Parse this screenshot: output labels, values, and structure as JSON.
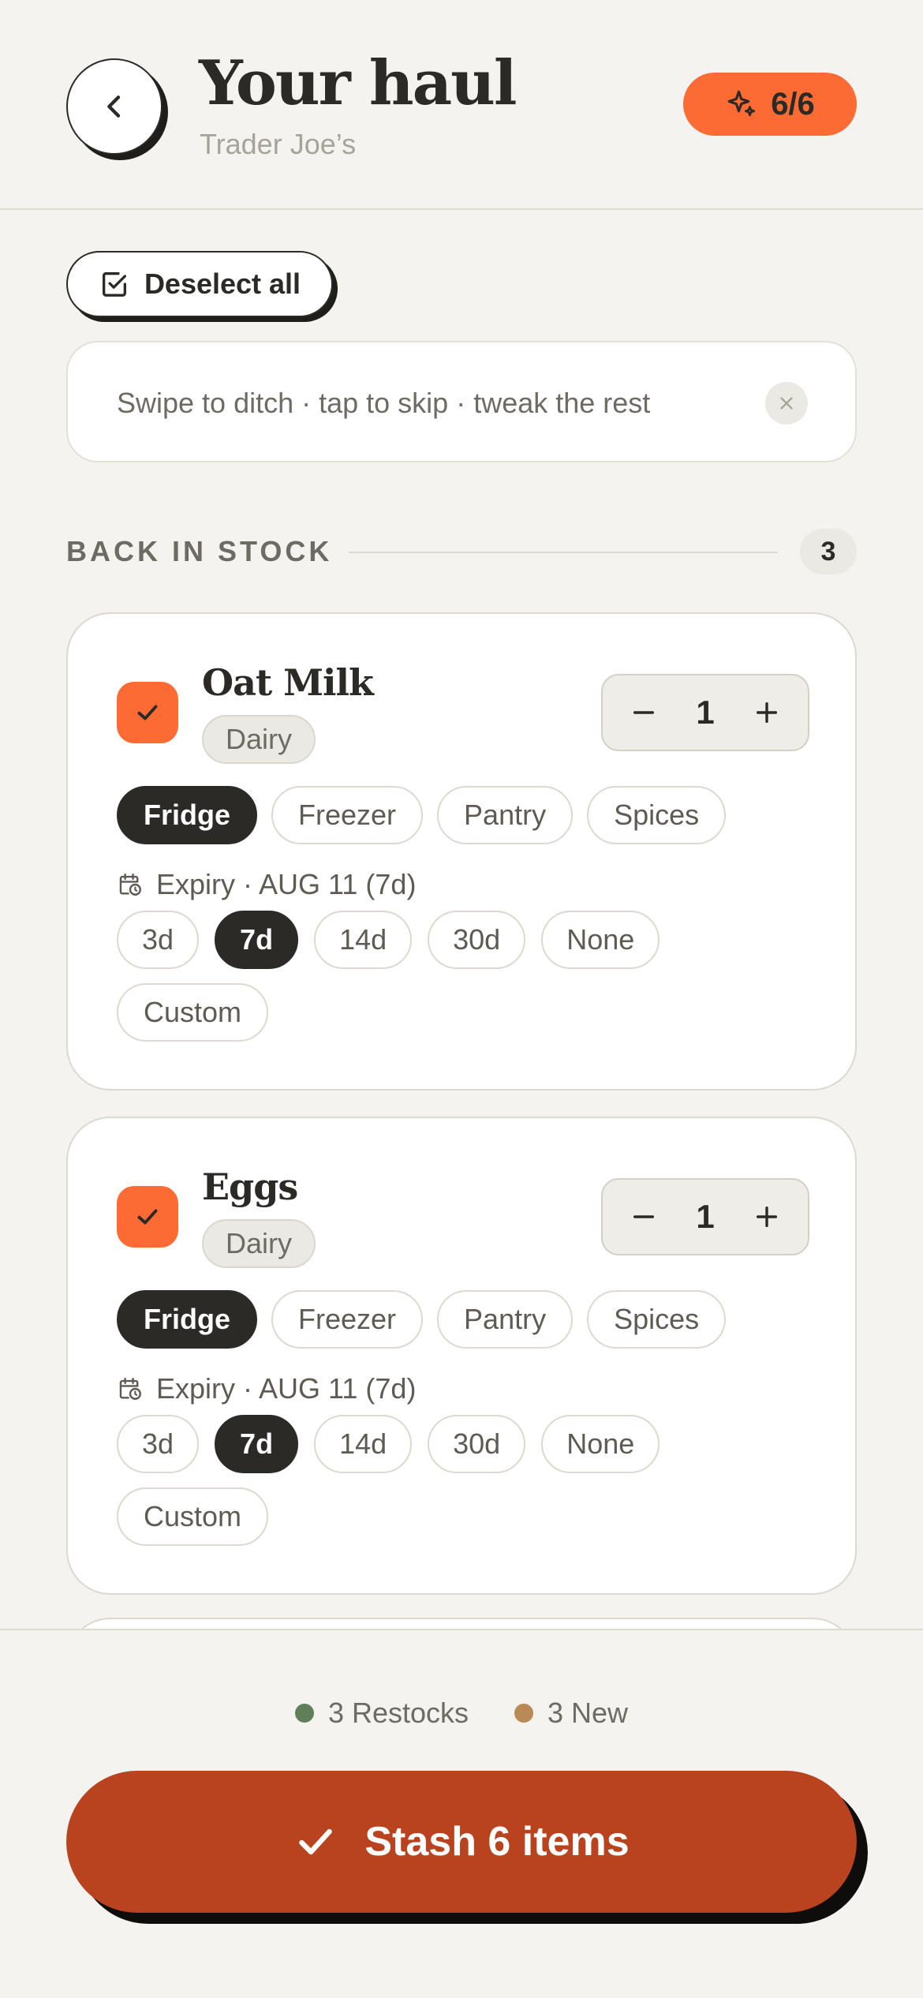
{
  "header": {
    "title": "Your haul",
    "store": "Trader Joe’s",
    "count_badge": "6/6"
  },
  "tools": {
    "deselect_label": "Deselect all",
    "hint_text": "Swipe to ditch · tap to skip · tweak the rest"
  },
  "section": {
    "title": "BACK IN STOCK",
    "count": "3"
  },
  "items": [
    {
      "name": "Oat Milk",
      "category": "Dairy",
      "quantity": "1",
      "checked": true,
      "storage_options": [
        "Fridge",
        "Freezer",
        "Pantry",
        "Spices"
      ],
      "storage_selected": "Fridge",
      "expiry_label": "Expiry · AUG 11 (7d)",
      "expiry_options": [
        "3d",
        "7d",
        "14d",
        "30d",
        "None"
      ],
      "expiry_selected": "7d",
      "custom_label": "Custom"
    },
    {
      "name": "Eggs",
      "category": "Dairy",
      "quantity": "1",
      "checked": true,
      "storage_options": [
        "Fridge",
        "Freezer",
        "Pantry",
        "Spices"
      ],
      "storage_selected": "Fridge",
      "expiry_label": "Expiry · AUG 11 (7d)",
      "expiry_options": [
        "3d",
        "7d",
        "14d",
        "30d",
        "None"
      ],
      "expiry_selected": "7d",
      "custom_label": "Custom"
    }
  ],
  "footer": {
    "restocks_label": "3 Restocks",
    "new_label": "3 New",
    "stash_label": "Stash 6 items"
  },
  "colors": {
    "accent": "#fb6b33",
    "stash_button": "#b9421f",
    "restock_dot": "#5f7f58",
    "new_dot": "#b98a55",
    "selected_chip": "#2b2a26"
  },
  "icons": {
    "back": "chevron-left-icon",
    "badge": "sparkle-icon",
    "deselect": "checkbox-icon",
    "close": "close-icon",
    "expiry": "calendar-clock-icon",
    "stash": "check-icon"
  }
}
